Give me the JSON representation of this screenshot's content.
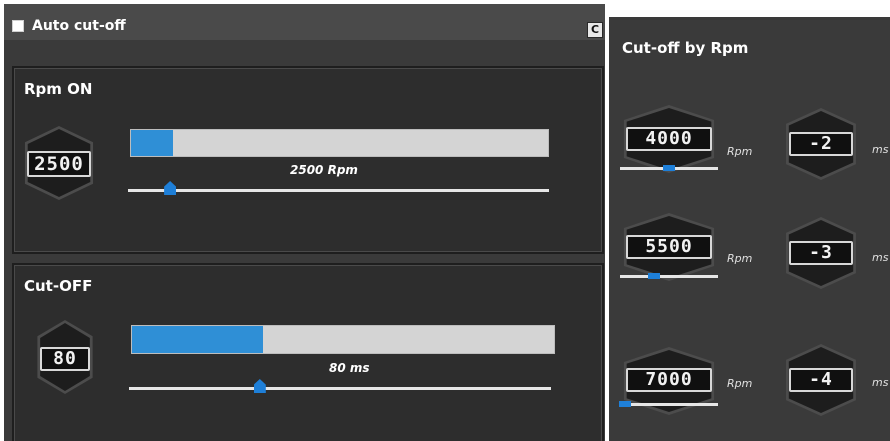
{
  "auto_cutoff": {
    "label": "Auto cut-off",
    "checked": false,
    "reset_glyph": "C"
  },
  "rpm_on": {
    "title": "Rpm ON",
    "display": "2500",
    "caption": "2500 Rpm",
    "level": 0.1
  },
  "cut_off": {
    "title": "Cut-OFF",
    "display": "80",
    "caption": "80 ms",
    "level": 0.31
  },
  "cutoff_by_rpm": {
    "title": "Cut-off by Rpm",
    "rows": [
      {
        "rpm": "4000",
        "rpm_unit": "Rpm",
        "time": "-2",
        "time_unit": "ms",
        "level": 0.5
      },
      {
        "rpm": "5500",
        "rpm_unit": "Rpm",
        "time": "-3",
        "time_unit": "ms",
        "level": 0.35
      },
      {
        "rpm": "7000",
        "rpm_unit": "Rpm",
        "time": "-4",
        "time_unit": "ms",
        "level": 0.05
      }
    ]
  },
  "colors": {
    "accent": "#2f8fd6",
    "panel": "#3a3a3a",
    "section": "#2d2d2d",
    "track": "#d4d4d4"
  },
  "icons": {
    "checkbox": "checkbox-icon",
    "reset": "reset-icon"
  }
}
